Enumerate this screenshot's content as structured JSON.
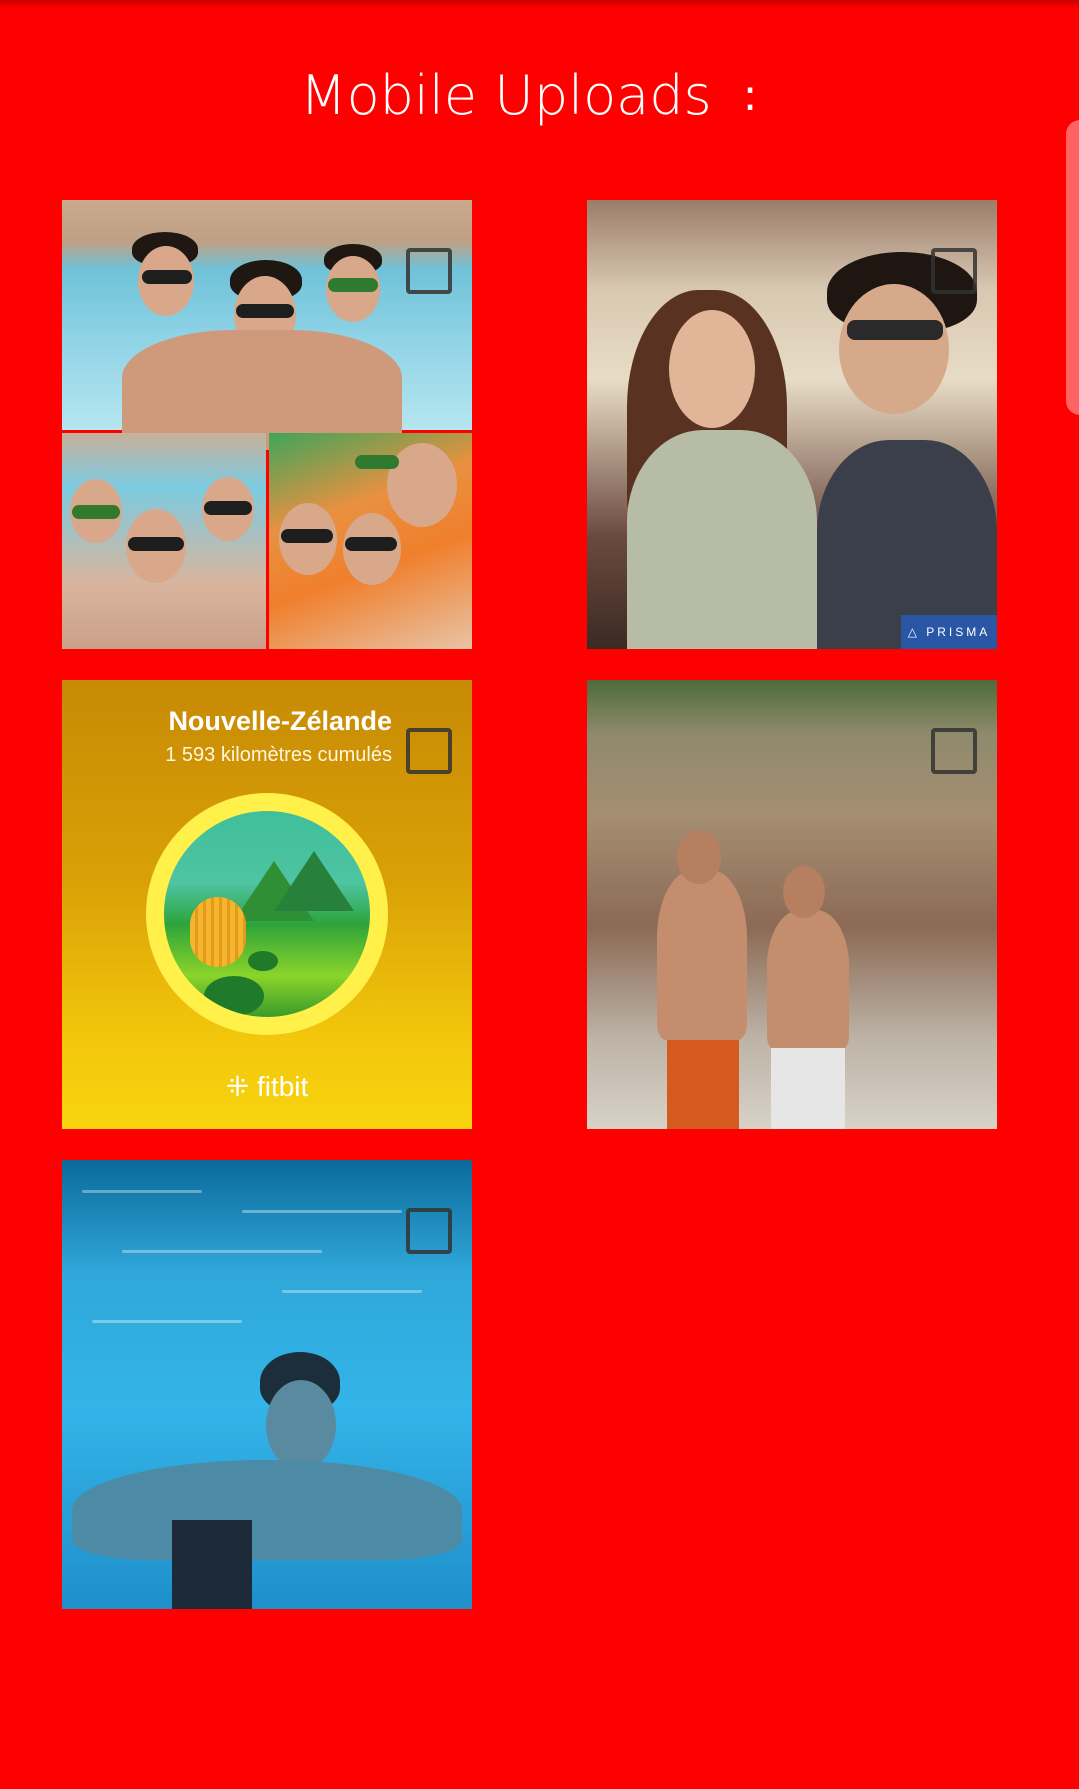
{
  "header": {
    "title": "Mobile Uploads",
    "menu_icon": ":"
  },
  "gallery": {
    "items": [
      {
        "description_icon": "photo-collage-pool"
      },
      {
        "description_icon": "photo-prisma-car",
        "badge": "PRISMA"
      },
      {
        "description_icon": "fitbit-badge",
        "title": "Nouvelle-Zélande",
        "subtitle": "1 593 kilomètres cumulés",
        "logo": "fitbit"
      },
      {
        "description_icon": "photo-canyon"
      },
      {
        "description_icon": "photo-underwater"
      }
    ]
  },
  "colors": {
    "background": "#ff0000",
    "title_text": "#ffffff"
  }
}
